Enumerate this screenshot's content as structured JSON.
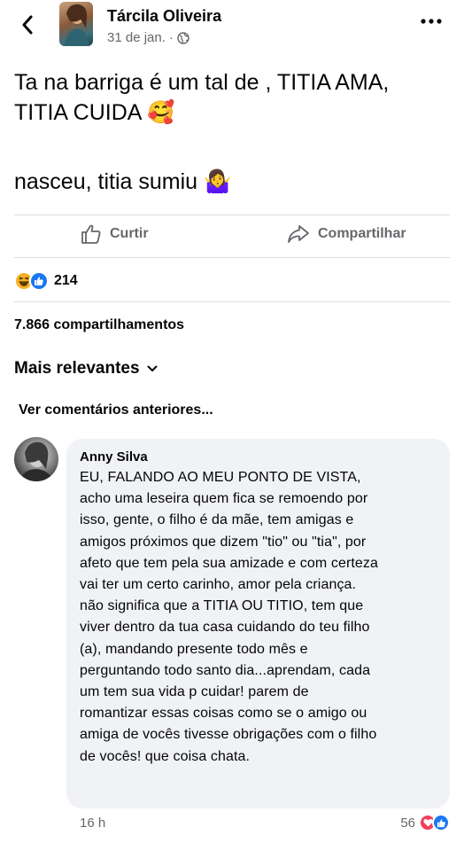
{
  "post": {
    "author": "Tárcila Oliveira",
    "date": "31 de jan.",
    "separator": "·",
    "text_lines": [
      "Ta na barriga é um tal de , TITIA AMA,",
      "TITIA CUIDA 🥰",
      "",
      "nasceu, titia sumiu 🤷‍♀️"
    ]
  },
  "actions": {
    "like_label": "Curtir",
    "share_label": "Compartilhar"
  },
  "reactions": {
    "count": "214",
    "types": [
      "haha",
      "like"
    ]
  },
  "shares": "7.866 compartilhamentos",
  "sort_label": "Mais relevantes",
  "previous_comments": "Ver comentários anteriores...",
  "comment": {
    "author": "Anny Silva",
    "lines": [
      "EU, FALANDO AO MEU PONTO DE VISTA,",
      "acho uma leseira quem fica se remoendo por",
      "isso, gente, o filho é da mãe, tem amigas e",
      "amigos próximos que dizem \"tio\" ou \"tia\", por",
      "afeto que tem pela sua amizade e com certeza",
      "vai ter um certo carinho, amor pela criança.",
      "não significa que a TITIA OU TITIO, tem que",
      "viver dentro da tua casa cuidando do teu filho",
      "(a), mandando presente todo mês e",
      "perguntando todo santo dia...aprendam, cada",
      "um tem sua vida p cuidar! parem de",
      "romantizar essas coisas como se o amigo ou",
      "amiga de vocês tivesse obrigações com o filho",
      "de vocês! que coisa chata."
    ],
    "time": "16 h",
    "reaction_count": "56",
    "reaction_types": [
      "love",
      "like"
    ]
  },
  "colors": {
    "secondary_text": "#65676b",
    "bubble": "#f0f2f5",
    "like_blue": "#1877f2",
    "love_red": "#f33e58",
    "haha_yellow": "#f7b125"
  }
}
